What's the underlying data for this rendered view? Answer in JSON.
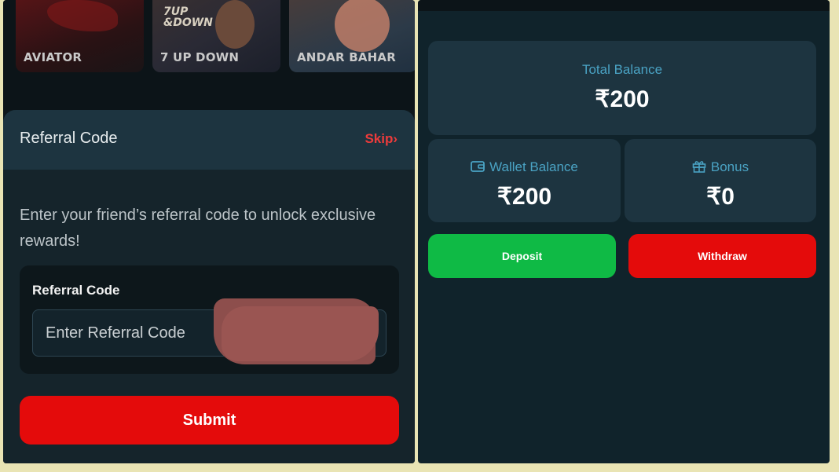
{
  "games": [
    {
      "label": "AVIATOR"
    },
    {
      "label": "7 UP DOWN",
      "logo": "7UP\n&DOWN"
    },
    {
      "label": "ANDAR BAHAR"
    }
  ],
  "referral_modal": {
    "title": "Referral Code",
    "skip_label": "Skip›",
    "description": "Enter your friend’s referral code to unlock exclusive rewards!",
    "field_label": "Referral Code",
    "input_placeholder": "Enter Referral Code",
    "input_value": "",
    "submit_label": "Submit"
  },
  "wallet": {
    "total_label": "Total Balance",
    "total_value": "₹200",
    "wallet_label": "Wallet Balance",
    "wallet_value": "₹200",
    "bonus_label": "Bonus",
    "bonus_value": "₹0",
    "deposit_label": "Deposit",
    "withdraw_label": "Withdraw"
  },
  "colors": {
    "accent_red": "#e40b0b",
    "accent_green": "#0fba45",
    "label_blue": "#4aa3c4"
  }
}
